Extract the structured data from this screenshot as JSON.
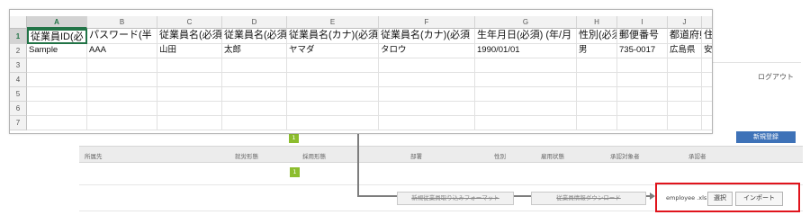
{
  "app": {
    "logout": "ログアウト",
    "new_registration": "新規登録",
    "grid_headers": [
      "所属先",
      "就労形態",
      "採用形態",
      "部署",
      "性別",
      "雇用状態",
      "承認対象者",
      "承認者"
    ],
    "pagination": {
      "current_top": "1",
      "current_bottom": "1"
    },
    "buttons": {
      "download_format": "新規従業員取り込みフォーマット",
      "download_employee_info": "従業員情報ダウンロード",
      "select": "選択",
      "import": "インポート"
    },
    "selected_file": "employee .xls"
  },
  "spreadsheet": {
    "columns": [
      "A",
      "B",
      "C",
      "D",
      "E",
      "F",
      "G",
      "H",
      "I",
      "J"
    ],
    "row_numbers": [
      "1",
      "2",
      "3",
      "4",
      "5",
      "6",
      "7"
    ],
    "selected_column": "A",
    "selected_row": "1",
    "header_row": [
      "従業員ID(必",
      "パスワード(半",
      "従業員名(必須",
      "従業員名(必須",
      "従業員名(カナ)(必須",
      "従業員名(カナ)(必須",
      "生年月日(必須) (年/月",
      "性別(必須",
      "郵便番号",
      "都道府県",
      "住"
    ],
    "sample_row": [
      "Sample",
      "AAA",
      "山田",
      "太郎",
      "ヤマダ",
      "タロウ",
      "1990/01/01",
      "男",
      "735-0017",
      "広島県",
      "安"
    ]
  },
  "colors": {
    "excel_green": "#217346",
    "brand_blue": "#3e72b8",
    "pager_green": "#8cbd2e",
    "highlight_red": "#e0141c"
  }
}
